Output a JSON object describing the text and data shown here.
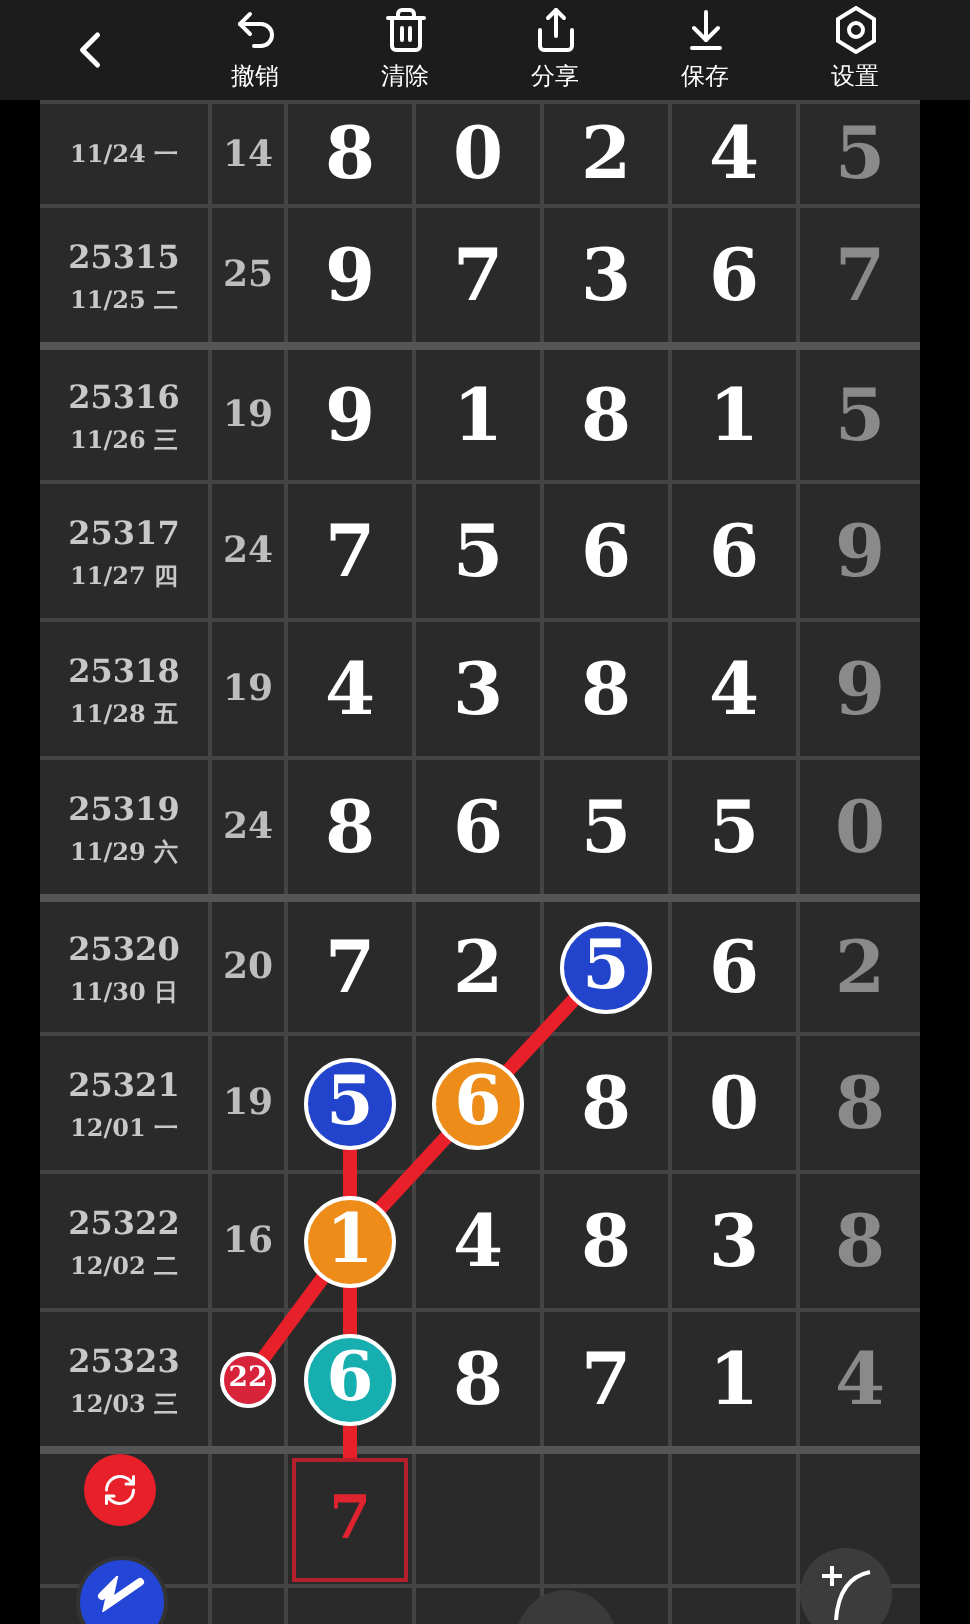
{
  "toolbar": {
    "items": [
      {
        "label": "撤销"
      },
      {
        "label": "清除"
      },
      {
        "label": "分享"
      },
      {
        "label": "保存"
      },
      {
        "label": "设置"
      }
    ]
  },
  "rows": [
    {
      "period": "",
      "date": "11/24 一",
      "sum": {
        "value": "14"
      },
      "digits": [
        {
          "value": "8"
        },
        {
          "value": "0"
        },
        {
          "value": "2"
        },
        {
          "value": "4"
        }
      ],
      "tail": "5",
      "divider_above": false
    },
    {
      "period": "25315",
      "date": "11/25 二",
      "sum": {
        "value": "25"
      },
      "digits": [
        {
          "value": "9"
        },
        {
          "value": "7"
        },
        {
          "value": "3"
        },
        {
          "value": "6"
        }
      ],
      "tail": "7",
      "divider_above": false
    },
    {
      "period": "25316",
      "date": "11/26 三",
      "sum": {
        "value": "19"
      },
      "digits": [
        {
          "value": "9"
        },
        {
          "value": "1"
        },
        {
          "value": "8"
        },
        {
          "value": "1"
        }
      ],
      "tail": "5",
      "divider_above": true
    },
    {
      "period": "25317",
      "date": "11/27 四",
      "sum": {
        "value": "24"
      },
      "digits": [
        {
          "value": "7"
        },
        {
          "value": "5"
        },
        {
          "value": "6"
        },
        {
          "value": "6"
        }
      ],
      "tail": "9",
      "divider_above": false
    },
    {
      "period": "25318",
      "date": "11/28 五",
      "sum": {
        "value": "19"
      },
      "digits": [
        {
          "value": "4"
        },
        {
          "value": "3"
        },
        {
          "value": "8"
        },
        {
          "value": "4"
        }
      ],
      "tail": "9",
      "divider_above": false
    },
    {
      "period": "25319",
      "date": "11/29 六",
      "sum": {
        "value": "24"
      },
      "digits": [
        {
          "value": "8"
        },
        {
          "value": "6"
        },
        {
          "value": "5"
        },
        {
          "value": "5"
        }
      ],
      "tail": "0",
      "divider_above": false
    },
    {
      "period": "25320",
      "date": "11/30 日",
      "sum": {
        "value": "20"
      },
      "digits": [
        {
          "value": "7"
        },
        {
          "value": "2"
        },
        {
          "value": "5",
          "color": "#2244cc"
        },
        {
          "value": "6"
        }
      ],
      "tail": "2",
      "divider_above": true
    },
    {
      "period": "25321",
      "date": "12/01 一",
      "sum": {
        "value": "19"
      },
      "digits": [
        {
          "value": "5",
          "color": "#2244cc"
        },
        {
          "value": "6",
          "color": "#ee8c1a"
        },
        {
          "value": "8"
        },
        {
          "value": "0"
        }
      ],
      "tail": "8",
      "divider_above": false
    },
    {
      "period": "25322",
      "date": "12/02 二",
      "sum": {
        "value": "16"
      },
      "digits": [
        {
          "value": "1",
          "color": "#ee8c1a"
        },
        {
          "value": "4"
        },
        {
          "value": "8"
        },
        {
          "value": "3"
        }
      ],
      "tail": "8",
      "divider_above": false
    },
    {
      "period": "25323",
      "date": "12/03 三",
      "sum": {
        "value": "22",
        "color": "#d8243a"
      },
      "digits": [
        {
          "value": "6",
          "color": "#17aeb0"
        },
        {
          "value": "8"
        },
        {
          "value": "7"
        },
        {
          "value": "1"
        }
      ],
      "tail": "4",
      "divider_above": false
    }
  ],
  "forecast": {
    "cells": [
      "7"
    ]
  }
}
